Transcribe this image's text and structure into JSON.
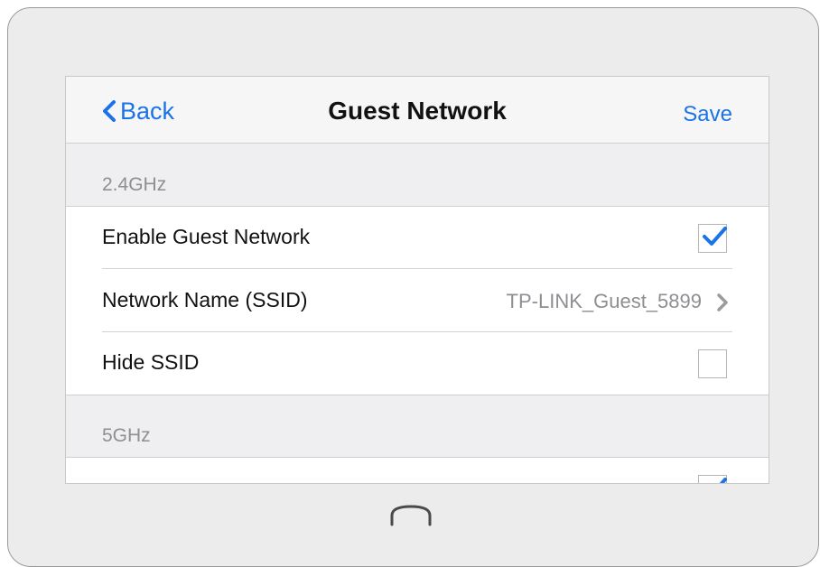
{
  "nav": {
    "back_label": "Back",
    "title": "Guest Network",
    "save_label": "Save"
  },
  "sections": [
    {
      "header": "2.4GHz",
      "rows": [
        {
          "label": "Enable Guest Network",
          "type": "checkbox",
          "checked": true
        },
        {
          "label": "Network Name (SSID)",
          "type": "disclosure",
          "value": "TP-LINK_Guest_5899"
        },
        {
          "label": "Hide SSID",
          "type": "checkbox",
          "checked": false
        }
      ]
    },
    {
      "header": "5GHz",
      "rows": [
        {
          "label": "",
          "type": "checkbox",
          "checked": true
        }
      ]
    }
  ],
  "icons": {
    "back": "chevron-left-icon",
    "disclosure": "chevron-right-icon",
    "check": "checkmark-icon",
    "home": "home-button-icon"
  },
  "colors": {
    "accent": "#1a73e8",
    "secondary_text": "#8e8e93",
    "section_bg": "#efeff1"
  }
}
